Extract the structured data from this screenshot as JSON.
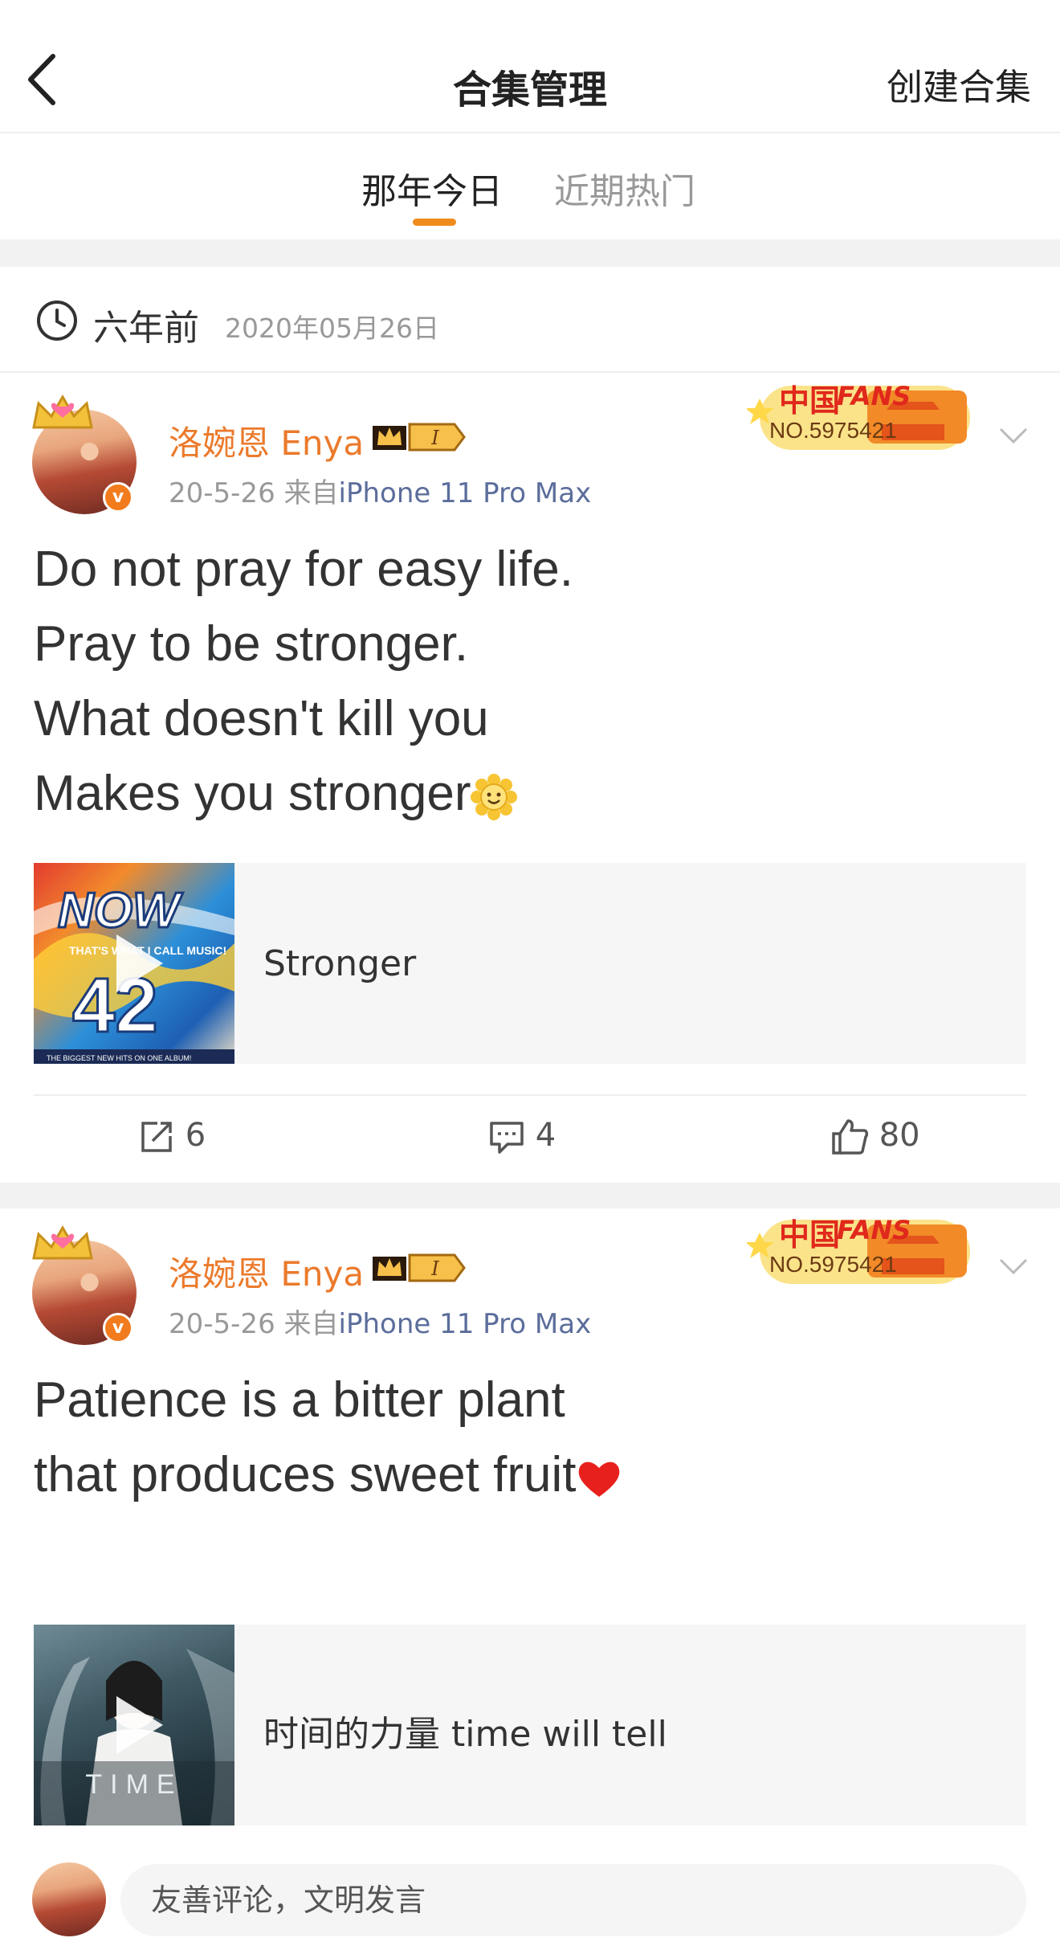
{
  "header": {
    "title": "合集管理",
    "action_label": "创建合集"
  },
  "tabs": [
    {
      "label": "那年今日",
      "active": true
    },
    {
      "label": "近期热门",
      "active": false
    }
  ],
  "date_row": {
    "ago": "六年前",
    "date": "2020年05月26日"
  },
  "posts": [
    {
      "username": "洛婉恩 Enya",
      "vip_level": "I",
      "time": "20-5-26",
      "source_prefix": "来自",
      "device": "iPhone 11 Pro Max",
      "fans_badge": {
        "cn": "中国",
        "en": "FANS",
        "number": "NO.5975421"
      },
      "text_lines": [
        "Do not pray for easy life.",
        "Pray to be stronger.",
        "What doesn't kill you",
        "Makes you stronger"
      ],
      "emoji": "sunflower-smile",
      "media": {
        "title": "Stronger",
        "cover_text": "NOW",
        "cover_number": "42",
        "cover_sub": "THAT'S WHAT I CALL MUSIC!",
        "cover_footer": "THE BIGGEST NEW HITS ON ONE ALBUM!"
      },
      "actions": {
        "repost": "6",
        "comment": "4",
        "like": "80"
      }
    },
    {
      "username": "洛婉恩 Enya",
      "vip_level": "I",
      "time": "20-5-26",
      "source_prefix": "来自",
      "device": "iPhone 11 Pro Max",
      "fans_badge": {
        "cn": "中国",
        "en": "FANS",
        "number": "NO.5975421"
      },
      "text_lines": [
        "Patience is a bitter plant",
        "that produces sweet fruit"
      ],
      "emoji": "red-heart",
      "media": {
        "title": "时间的力量 time will tell",
        "cover_text": "TIME"
      }
    }
  ],
  "comment_bar": {
    "placeholder": "友善评论，文明发言"
  },
  "colors": {
    "accent": "#f08c1e",
    "username": "#eb7a2c",
    "device": "#5b6d9b"
  }
}
